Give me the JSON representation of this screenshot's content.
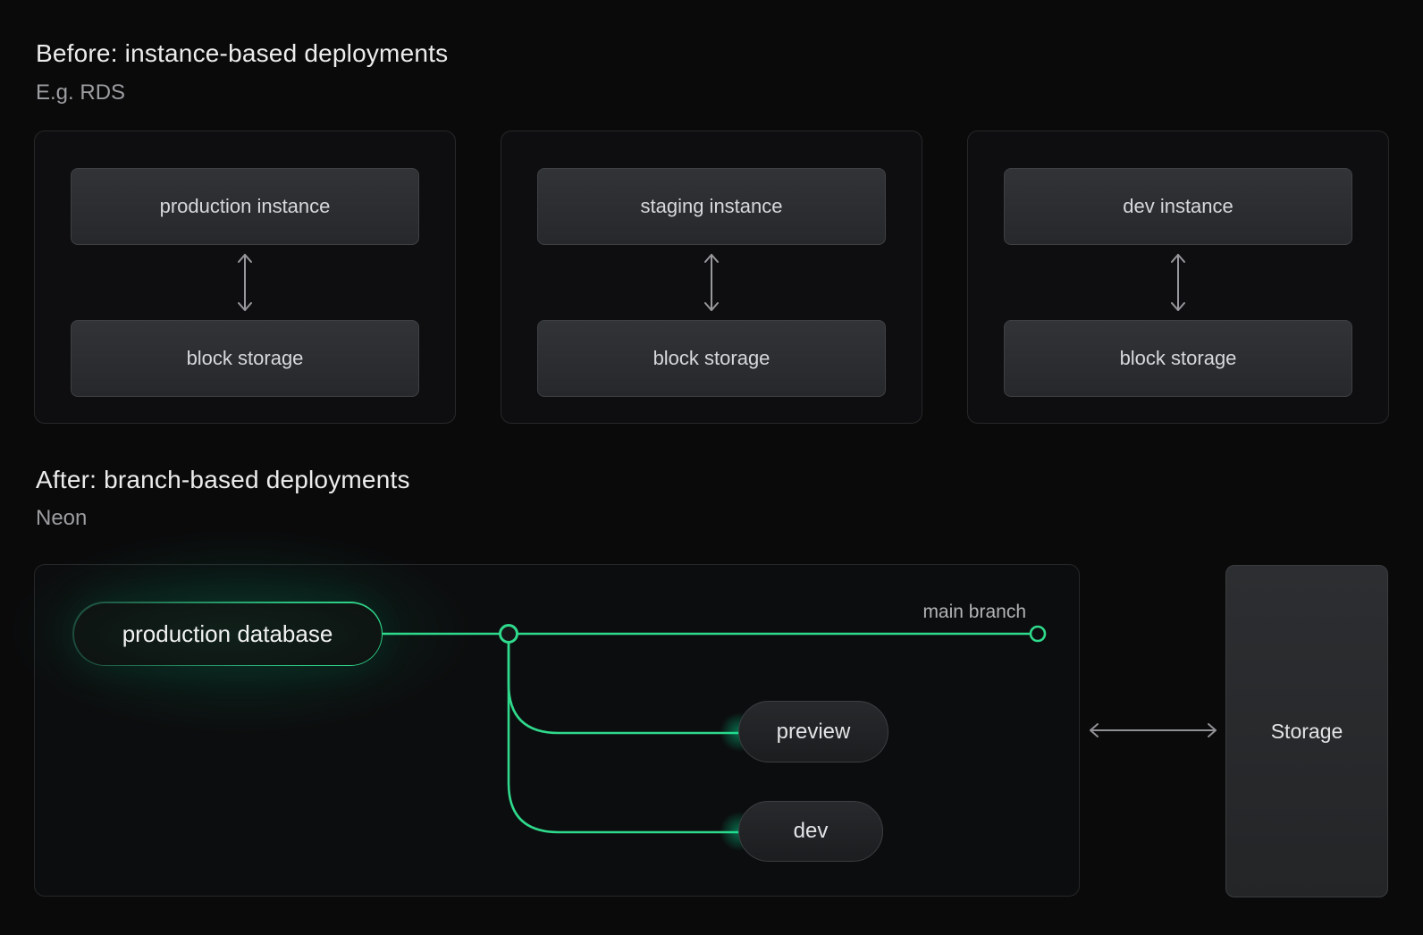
{
  "colors": {
    "background": "#0a0a0b",
    "accent_green": "#2fd98c",
    "arrow_gray": "#96989b",
    "card_border": "#272829",
    "node_text": "#d7d8da"
  },
  "before": {
    "title": "Before: instance-based deployments",
    "subtitle": "E.g. RDS",
    "cards": [
      {
        "top": "production instance",
        "bottom": "block storage"
      },
      {
        "top": "staging instance",
        "bottom": "block storage"
      },
      {
        "top": "dev instance",
        "bottom": "block storage"
      }
    ]
  },
  "after": {
    "title": "After: branch-based deployments",
    "subtitle": "Neon",
    "root_node": "production database",
    "main_branch_label": "main branch",
    "branches": [
      {
        "label": "preview"
      },
      {
        "label": "dev"
      }
    ],
    "storage_label": "Storage"
  }
}
